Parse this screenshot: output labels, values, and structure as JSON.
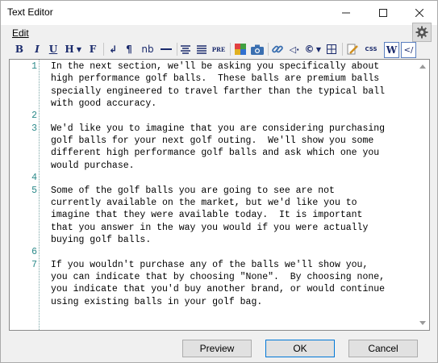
{
  "window": {
    "title": "Text Editor"
  },
  "menu": {
    "edit": "Edit"
  },
  "toolbar": {
    "bold": "B",
    "italic": "I",
    "underline": "U",
    "heading": "H",
    "font": "F",
    "nb": "nb",
    "pre": "PRE",
    "css": "CSS",
    "word": "W",
    "code": "</"
  },
  "editor": {
    "lines": [
      {
        "num": "1",
        "text": "In the next section, we'll be asking you specifically about"
      },
      {
        "num": "",
        "text": "high performance golf balls.  These balls are premium balls"
      },
      {
        "num": "",
        "text": "specially engineered to travel farther than the typical ball"
      },
      {
        "num": "",
        "text": "with good accuracy."
      },
      {
        "num": "2",
        "text": ""
      },
      {
        "num": "3",
        "text": "We'd like you to imagine that you are considering purchasing"
      },
      {
        "num": "",
        "text": "golf balls for your next golf outing.  We'll show you some"
      },
      {
        "num": "",
        "text": "different high performance golf balls and ask which one you"
      },
      {
        "num": "",
        "text": "would purchase."
      },
      {
        "num": "4",
        "text": ""
      },
      {
        "num": "5",
        "text": "Some of the golf balls you are going to see are not"
      },
      {
        "num": "",
        "text": "currently available on the market, but we'd like you to"
      },
      {
        "num": "",
        "text": "imagine that they were available today.  It is important"
      },
      {
        "num": "",
        "text": "that you answer in the way you would if you were actually"
      },
      {
        "num": "",
        "text": "buying golf balls."
      },
      {
        "num": "6",
        "text": ""
      },
      {
        "num": "7",
        "text": "If you wouldn't purchase any of the balls we'll show you,"
      },
      {
        "num": "",
        "text": "you can indicate that by choosing \"None\".  By choosing none,"
      },
      {
        "num": "",
        "text": "you indicate that you'd buy another brand, or would continue"
      },
      {
        "num": "",
        "text": "using existing balls in your golf bag."
      }
    ]
  },
  "buttons": {
    "preview": "Preview",
    "ok": "OK",
    "cancel": "Cancel"
  }
}
